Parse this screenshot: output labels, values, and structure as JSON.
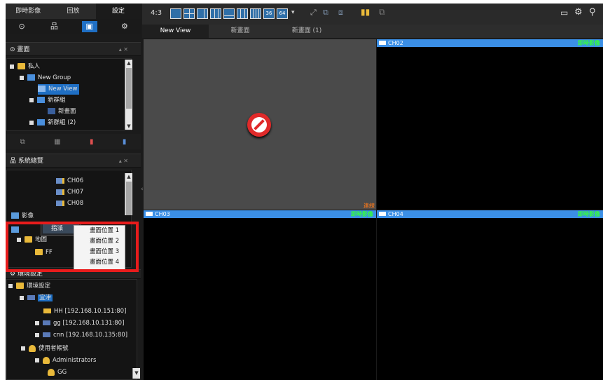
{
  "left_tabs": [
    "即時影像",
    "回放",
    "設定"
  ],
  "left_icons": [
    "view-icon",
    "network-icon",
    "map-icon",
    "settings-icon"
  ],
  "screen_section": {
    "title": "畫面",
    "controls": "▴ ✕",
    "tree": [
      {
        "label": "私人",
        "icon": "folder-icon"
      },
      {
        "label": "New Group",
        "icon": "group-icon"
      },
      {
        "label": "New View",
        "icon": "layout-icon",
        "selected": true
      },
      {
        "label": "新群組",
        "icon": "group-icon"
      },
      {
        "label": "新畫面",
        "icon": "layout-icon"
      },
      {
        "label": "新群組 (2)",
        "icon": "group-icon"
      }
    ],
    "toolbar_icons": [
      "add-group-icon",
      "add-view-icon",
      "paint-icon",
      "delete-icon"
    ]
  },
  "system_section": {
    "title": "系統總覽",
    "controls": "▴ ✕",
    "tree": [
      {
        "label": "CH06",
        "icon": "camera-icon"
      },
      {
        "label": "CH07",
        "icon": "camera-icon"
      },
      {
        "label": "CH08",
        "icon": "camera-icon"
      },
      {
        "label": "影像",
        "icon": "image-icon"
      },
      {
        "label": "地圖",
        "icon": "map-icon"
      },
      {
        "label": "FF",
        "icon": "map-icon"
      }
    ]
  },
  "context_menu": {
    "parent_item": "指派",
    "submenu": [
      "畫面位置 1",
      "畫面位置 2",
      "畫面位置 3",
      "畫面位置 4"
    ]
  },
  "env_section": {
    "title": "環境設定",
    "tree": [
      {
        "label": "環境設定",
        "icon": "folder-icon"
      },
      {
        "label": "宜津",
        "icon": "server-icon",
        "selected": true
      },
      {
        "label": "HH [192.168.10.151:80]",
        "icon": "device-icon"
      },
      {
        "label": "gg [192.168.10.131:80]",
        "icon": "device-icon"
      },
      {
        "label": "cnn [192.168.10.135:80]",
        "icon": "device-icon"
      },
      {
        "label": "使用者帳號",
        "icon": "users-icon"
      },
      {
        "label": "Administrators",
        "icon": "users-icon"
      },
      {
        "label": "GG",
        "icon": "user-icon"
      }
    ]
  },
  "toolbar": {
    "aspect_ratio": "4:3",
    "layout_buttons": [
      "layout-1x1",
      "layout-2x2",
      "layout-1+5",
      "layout-3x3",
      "layout-1+7",
      "layout-4x4",
      "layout-5x5",
      "layout-36",
      "layout-64"
    ],
    "layout_36_label": "36",
    "layout_64_label": "64",
    "right_icons": [
      "screen-icon",
      "gear-icon",
      "search-icon"
    ]
  },
  "view_tabs": [
    "New View",
    "新畫面",
    "新畫面 (1)"
  ],
  "channels": [
    {
      "name": "",
      "status": "",
      "no_signal": true,
      "footer": "連線"
    },
    {
      "name": "CH02",
      "status": "即時影像"
    },
    {
      "name": "CH03",
      "status": "即時影像"
    },
    {
      "name": "CH04",
      "status": "即時影像"
    }
  ],
  "colors": {
    "accent": "#3b8fe6",
    "status_live": "#35ff3a",
    "status_warn": "#ff7a1a",
    "highlight_box": "#e81c1c"
  }
}
